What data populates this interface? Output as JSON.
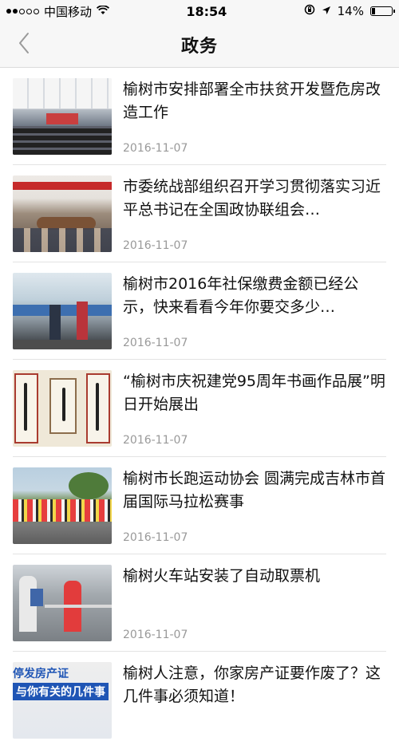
{
  "status_bar": {
    "carrier": "中国移动",
    "time": "18:54",
    "battery": "14%",
    "battery_level": 0.14
  },
  "header": {
    "title": "政务"
  },
  "news": [
    {
      "title": "榆树市安排部署全市扶贫开发暨危房改造工作",
      "date": "2016-11-07"
    },
    {
      "title": "市委统战部组织召开学习贯彻落实习近平总书记在全国政协联组会…",
      "date": "2016-11-07"
    },
    {
      "title": "榆树市2016年社保缴费金额已经公示，快来看看今年你要交多少…",
      "date": "2016-11-07"
    },
    {
      "title": "“榆树市庆祝建党95周年书画作品展”明日开始展出",
      "date": "2016-11-07"
    },
    {
      "title": "榆树市长跑运动协会 圆满完成吉林市首届国际马拉松赛事",
      "date": "2016-11-07"
    },
    {
      "title": "榆树火车站安装了自动取票机",
      "date": "2016-11-07"
    },
    {
      "title": "榆树人注意，你家房产证要作废了？这几件事必须知道！",
      "date": "",
      "image_text_line1": "停发房产证",
      "image_text_line2": "与你有关的几件事"
    }
  ],
  "icons": {
    "back": "chevron-left-icon",
    "wifi": "wifi-icon",
    "location": "location-arrow-icon",
    "rotation_lock": "rotation-lock-icon"
  }
}
